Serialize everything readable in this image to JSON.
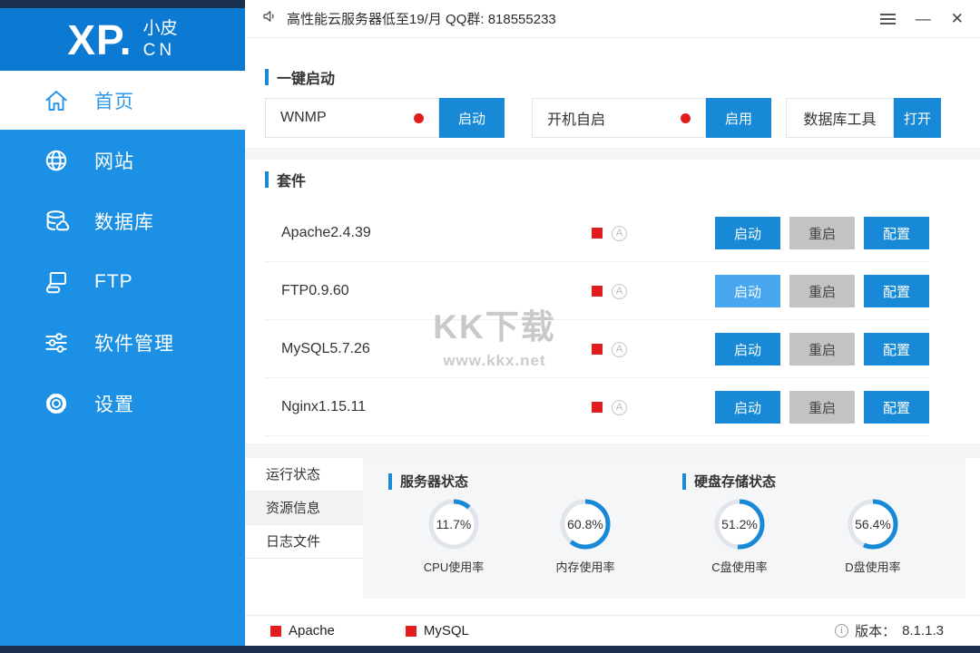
{
  "colors": {
    "primary_blue": "#1789d6",
    "sidebar_blue": "#1b90e4",
    "logo_blue": "#0c7ad2",
    "danger_red": "#e21d1d",
    "frame_navy": "#1b2f4e",
    "panel_gray": "#f5f6f8"
  },
  "window_controls": {
    "minimize_glyph": "—",
    "close_glyph": "✕"
  },
  "sidebar": {
    "logo": {
      "main": "XP.",
      "sub1": "小皮",
      "sub2": "CN"
    },
    "items": [
      {
        "label": "首页",
        "icon": "home-icon",
        "active": true
      },
      {
        "label": "网站",
        "icon": "globe-icon",
        "active": false
      },
      {
        "label": "数据库",
        "icon": "database-icon",
        "active": false
      },
      {
        "label": "FTP",
        "icon": "network-icon",
        "active": false
      },
      {
        "label": "软件管理",
        "icon": "sliders-icon",
        "active": false
      },
      {
        "label": "设置",
        "icon": "gear-icon",
        "active": false
      }
    ]
  },
  "topbar": {
    "announcement": "高性能云服务器低至19/月  QQ群: 818555233"
  },
  "quick_start": {
    "title": "一键启动",
    "controls": [
      {
        "label": "WNMP",
        "button": "启动",
        "has_status_dot": true
      },
      {
        "label": "开机自启",
        "button": "启用",
        "has_status_dot": true
      },
      {
        "label": "数据库工具",
        "button": "打开",
        "has_status_dot": false
      }
    ]
  },
  "suite": {
    "title": "套件",
    "autostart_glyph": "A",
    "rows": [
      {
        "name": "Apache2.4.39",
        "buttons": [
          "启动",
          "重启",
          "配置"
        ]
      },
      {
        "name": "FTP0.9.60",
        "buttons": [
          "启动",
          "重启",
          "配置"
        ]
      },
      {
        "name": "MySQL5.7.26",
        "buttons": [
          "启动",
          "重启",
          "配置"
        ]
      },
      {
        "name": "Nginx1.15.11",
        "buttons": [
          "启动",
          "重启",
          "配置"
        ]
      }
    ]
  },
  "status_panel": {
    "tabs": [
      {
        "label": "运行状态",
        "active": false
      },
      {
        "label": "资源信息",
        "active": true
      },
      {
        "label": "日志文件",
        "active": false
      }
    ],
    "server_status": {
      "title": "服务器状态",
      "gauges": [
        {
          "value": "11.7%",
          "percent": 11.7,
          "label": "CPU使用率"
        },
        {
          "value": "60.8%",
          "percent": 60.8,
          "label": "内存使用率"
        }
      ]
    },
    "disk_status": {
      "title": "硬盘存储状态",
      "gauges": [
        {
          "value": "51.2%",
          "percent": 51.2,
          "label": "C盘使用率"
        },
        {
          "value": "56.4%",
          "percent": 56.4,
          "label": "D盘使用率"
        }
      ]
    }
  },
  "footer": {
    "services": [
      {
        "name": "Apache"
      },
      {
        "name": "MySQL"
      }
    ],
    "info_glyph": "i",
    "version_label": "版本：",
    "version": "8.1.1.3"
  },
  "watermark": {
    "line1": "KK下载",
    "line2": "www.kkx.net"
  },
  "chart_data": {
    "type": "pie",
    "title": "资源信息仪表",
    "series": [
      {
        "name": "CPU使用率",
        "values": [
          11.7
        ]
      },
      {
        "name": "内存使用率",
        "values": [
          60.8
        ]
      },
      {
        "name": "C盘使用率",
        "values": [
          51.2
        ]
      },
      {
        "name": "D盘使用率",
        "values": [
          56.4
        ]
      }
    ]
  }
}
